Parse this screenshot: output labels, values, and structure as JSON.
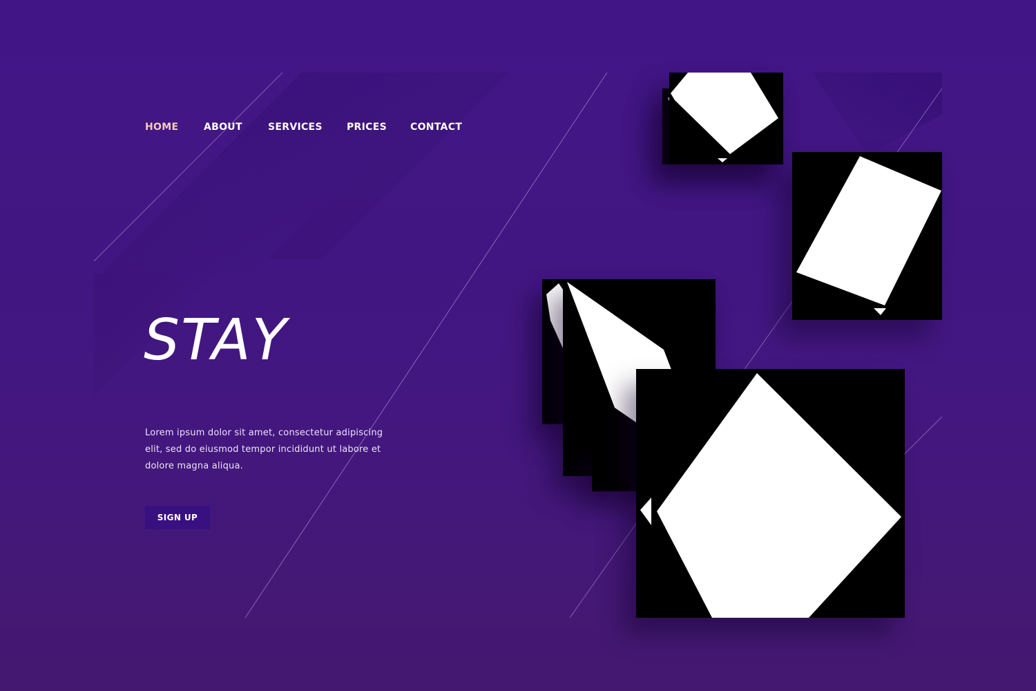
{
  "nav": {
    "items": [
      {
        "label": "HOME",
        "active": true
      },
      {
        "label": "ABOUT",
        "active": false
      },
      {
        "label": "SERVICES",
        "active": false
      },
      {
        "label": "PRICES",
        "active": false
      },
      {
        "label": "CONTACT",
        "active": false
      }
    ]
  },
  "hero": {
    "title": "STAY",
    "body": "Lorem ipsum dolor sit amet, consectetur adipiscing elit, sed do eiusmod tempor incididunt ut labore et dolore magna aliqua.",
    "cta_label": "SIGN UP"
  },
  "colors": {
    "background": "#42167f",
    "nav_active": "#f3cdb8",
    "button": "#381080",
    "text": "#ffffff"
  }
}
